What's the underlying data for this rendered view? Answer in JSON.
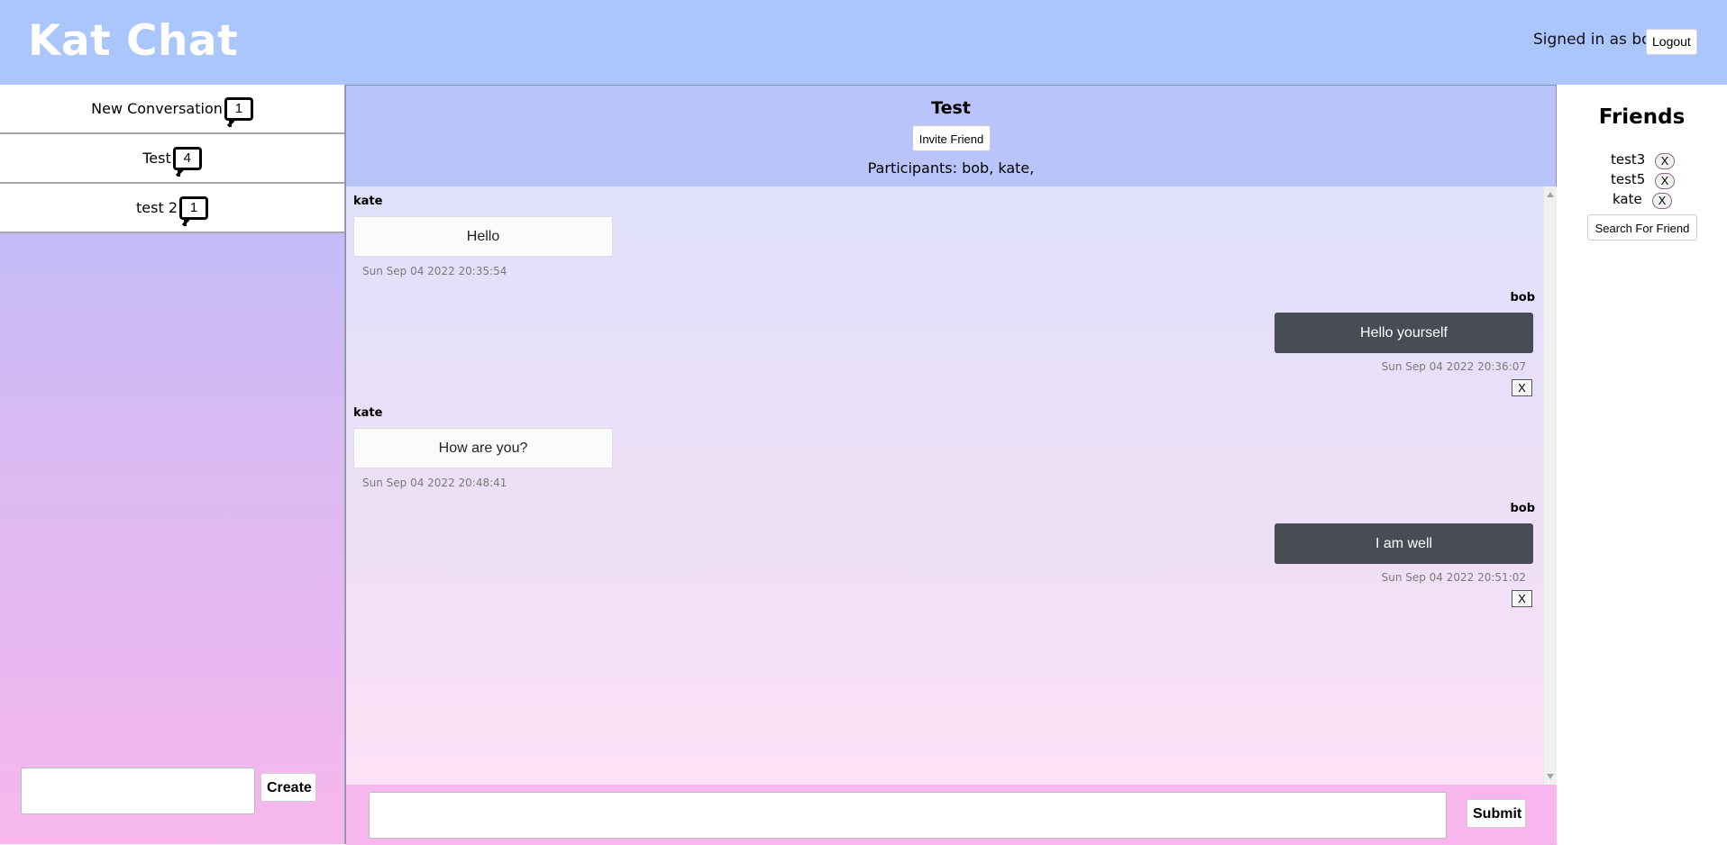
{
  "header": {
    "app_title": "Kat Chat",
    "signed_in_text": "Signed in as bob",
    "logout_label": "Logout"
  },
  "conversations": [
    {
      "name": "New Conversation",
      "count": "1"
    },
    {
      "name": "Test",
      "count": "4"
    },
    {
      "name": "test 2",
      "count": "1"
    }
  ],
  "create": {
    "value": "",
    "button_label": "Create"
  },
  "chat": {
    "title": "Test",
    "invite_label": "Invite Friend",
    "participants": "Participants: bob, kate,",
    "messages": [
      {
        "sender": "kate",
        "text": "Hello",
        "timestamp": "Sun Sep 04 2022 20:35:54",
        "own": false
      },
      {
        "sender": "bob",
        "text": "Hello yourself",
        "timestamp": "Sun Sep 04 2022 20:36:07",
        "own": true,
        "delete_label": "X"
      },
      {
        "sender": "kate",
        "text": "How are you?",
        "timestamp": "Sun Sep 04 2022 20:48:41",
        "own": false
      },
      {
        "sender": "bob",
        "text": "I am well",
        "timestamp": "Sun Sep 04 2022 20:51:02",
        "own": true,
        "delete_label": "X"
      }
    ],
    "compose_value": "",
    "submit_label": "Submit"
  },
  "friends": {
    "title": "Friends",
    "list": [
      {
        "name": "test3",
        "remove_label": "X"
      },
      {
        "name": "test5",
        "remove_label": "X"
      },
      {
        "name": "kate",
        "remove_label": "X"
      }
    ],
    "search_label": "Search For Friend"
  },
  "colors": {
    "header_bg": "#abc5fd",
    "chat_header_bg": "#b8c4fa",
    "own_message_bg": "#484d55",
    "compose_bg": "#f8b6ee"
  }
}
